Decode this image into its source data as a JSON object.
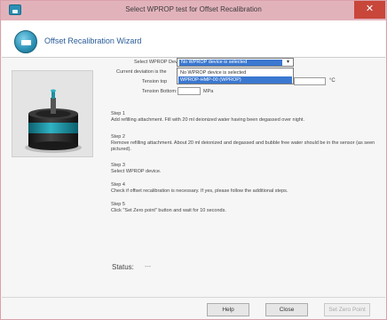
{
  "window": {
    "title": "Select WPROP test for Offset Recalibration",
    "close_glyph": "✕"
  },
  "wizard": {
    "title": "Offset Recalibration Wizard"
  },
  "form": {
    "device_label": "Select WPROP Device:",
    "device_selected": "No WPROP device is selected",
    "device_options": [
      "No WPROP device is selected",
      "WPROP-HMP-00 (WPROP)"
    ],
    "current_label": "Current deviation is the",
    "tension_top_label": "Tension top",
    "tension_bottom_label": "Tension Bottom:",
    "tension_bottom_unit": "MPa",
    "right_unit": "°C"
  },
  "steps": [
    {
      "heading": "Step 1",
      "text": "Add refilling attachment. Fill with 20 ml deionized water having been degassed over night."
    },
    {
      "heading": "Step 2",
      "text": "Remove refilling attachment. About 20 ml deionized and degassed and bubble free water should be in the sensor (as seen pictured)."
    },
    {
      "heading": "Step 3",
      "text": "Select WPROP device."
    },
    {
      "heading": "Step 4",
      "text": "Check if offset recalibration is necessary. If yes, please follow the additional steps."
    },
    {
      "heading": "Step 5",
      "text": "Click \"Set Zero point\" button and wait for 10 seconds."
    }
  ],
  "status": {
    "label": "Status:",
    "value": "---"
  },
  "buttons": {
    "help": "Help",
    "close": "Close",
    "set_zero": "Set Zero Point"
  },
  "colors": {
    "titlebar": "#e2b2bb",
    "close": "#c8463a",
    "selection": "#3b78d0",
    "device_body": "#2b2b2b",
    "device_band": "#1f8fa3"
  }
}
